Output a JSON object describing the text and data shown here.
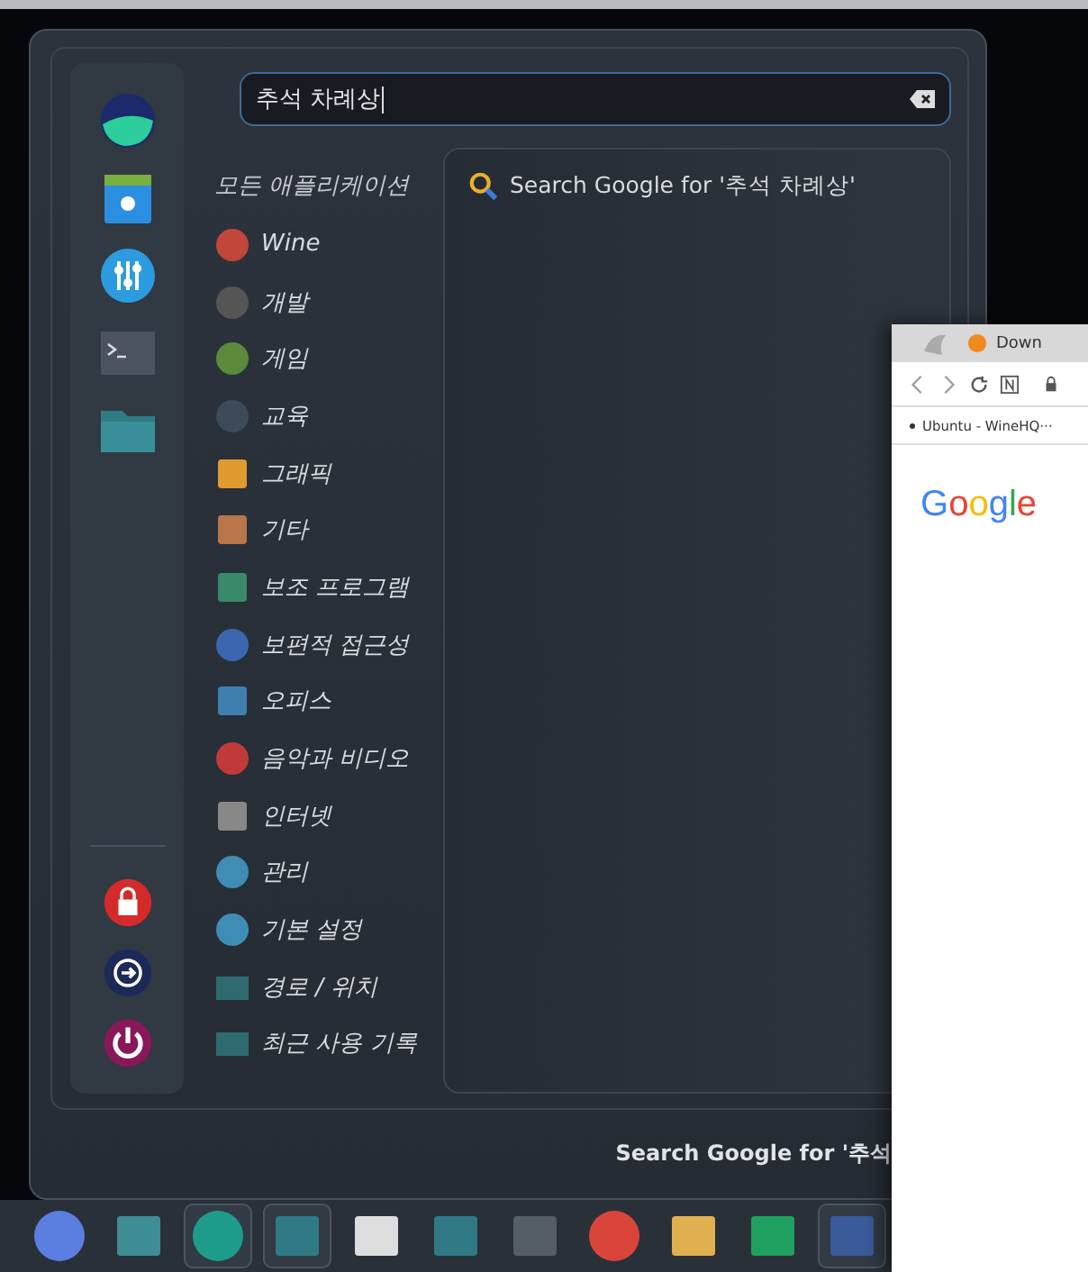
{
  "menu": {
    "search": {
      "value": "추석 차례상"
    },
    "categories_title": "모든 애플리케이션",
    "categories": [
      {
        "label": "Wine"
      },
      {
        "label": "개발"
      },
      {
        "label": "게임"
      },
      {
        "label": "교육"
      },
      {
        "label": "그래픽"
      },
      {
        "label": "기타"
      },
      {
        "label": "보조 프로그램"
      },
      {
        "label": "보편적 접근성"
      },
      {
        "label": "오피스"
      },
      {
        "label": "음악과 비디오"
      },
      {
        "label": "인터넷"
      },
      {
        "label": "관리"
      },
      {
        "label": "기본 설정"
      },
      {
        "label": "경로 / 위치"
      },
      {
        "label": "최근 사용 기록"
      }
    ],
    "results": [
      {
        "label": "Search Google for '추석 차례상'"
      }
    ],
    "status": "Search Google for '추석"
  },
  "browser": {
    "tab_title": "Down",
    "bookmark": "Ubuntu - WineHQ···",
    "logo": "Google"
  },
  "taskbar": [
    {
      "active": false
    },
    {
      "active": false
    },
    {
      "active": true
    },
    {
      "active": true
    },
    {
      "active": false
    },
    {
      "active": false
    },
    {
      "active": false
    },
    {
      "active": false
    },
    {
      "active": false
    },
    {
      "active": false
    },
    {
      "active": true
    }
  ]
}
